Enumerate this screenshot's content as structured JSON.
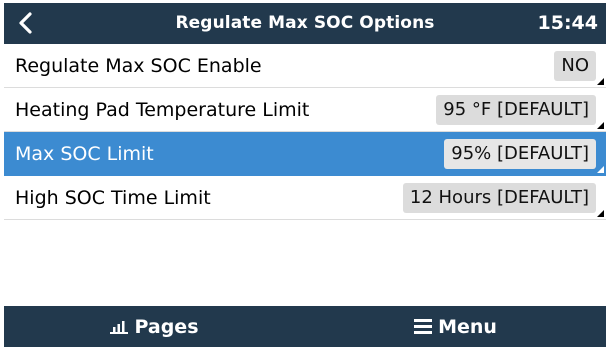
{
  "header": {
    "title": "Regulate Max SOC Options",
    "time": "15:44",
    "back_icon": "chevron-left-icon"
  },
  "settings": [
    {
      "label": "Regulate Max SOC Enable",
      "value": "NO",
      "selected": false
    },
    {
      "label": "Heating Pad Temperature Limit",
      "value": "95 °F [DEFAULT]",
      "selected": false
    },
    {
      "label": "Max SOC Limit",
      "value": "95% [DEFAULT]",
      "selected": true
    },
    {
      "label": "High SOC Time Limit",
      "value": "12 Hours [DEFAULT]",
      "selected": false
    }
  ],
  "footer": {
    "pages_label": "Pages",
    "pages_icon": "bar-chart-icon",
    "menu_label": "Menu",
    "menu_icon": "hamburger-menu-icon"
  },
  "colors": {
    "header_bg": "#22394d",
    "selected_bg": "#3c8bd1",
    "value_bg": "#dcdcdc"
  }
}
